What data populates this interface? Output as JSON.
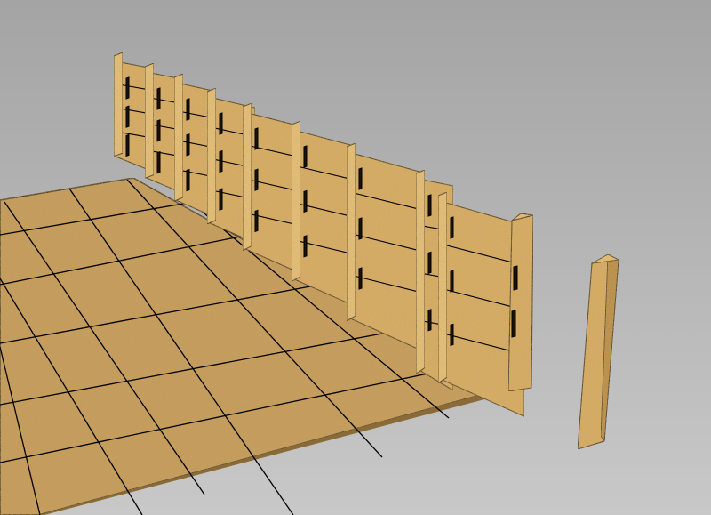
{
  "viewport": {
    "background_top": "#a4a4a4",
    "background_bottom": "#c8c8c8"
  },
  "materials": {
    "osb_base": "#d9ad63",
    "osb_light": "#e8c27a",
    "osb_dark": "#b88942",
    "floor_base": "#c49a58",
    "edge_line": "#000000",
    "shadow": "#8a6a36"
  },
  "scene": {
    "floor_tile_grid": "8x6",
    "wall_panel_count": 11,
    "loose_post_count": 1
  }
}
